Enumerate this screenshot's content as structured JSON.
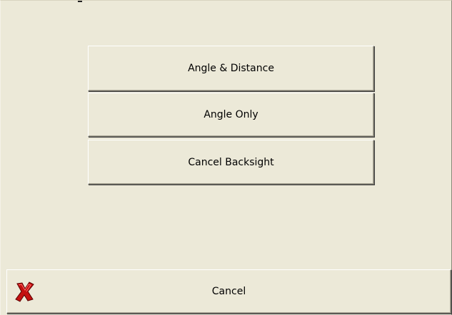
{
  "options": [
    {
      "label": "Angle & Distance"
    },
    {
      "label": "Angle Only"
    },
    {
      "label": "Cancel Backsight"
    }
  ],
  "footer": {
    "cancel_label": "Cancel",
    "cancel_icon": "red-x-icon"
  },
  "colors": {
    "dialog_background": "#ECE9D8",
    "button_face": "#ECE9D8",
    "icon_red": "#C41010"
  }
}
